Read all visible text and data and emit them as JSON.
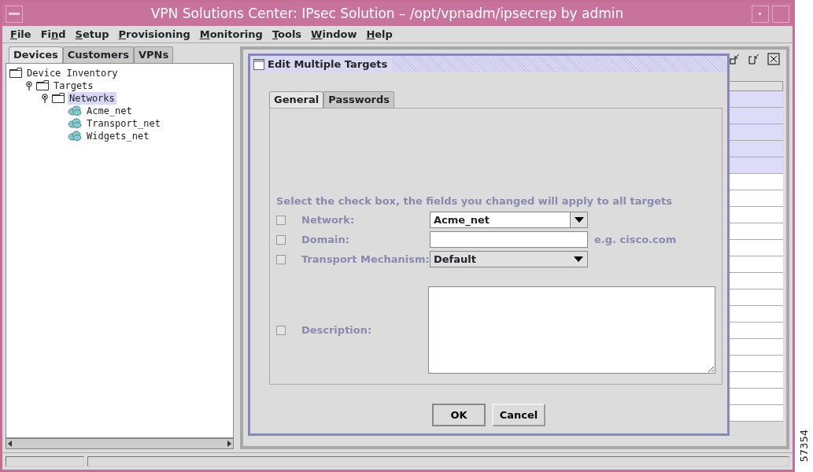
{
  "window": {
    "title": "VPN Solutions Center: IPsec Solution – /opt/vpnadm/ipsecrep by admin"
  },
  "menu": [
    {
      "segments": [
        {
          "text": "F",
          "underlined": true
        },
        {
          "text": "ile",
          "underlined": false
        }
      ]
    },
    {
      "segments": [
        {
          "text": "Fi",
          "underlined": false
        },
        {
          "text": "n",
          "underlined": true
        },
        {
          "text": "d",
          "underlined": false
        }
      ]
    },
    {
      "segments": [
        {
          "text": "S",
          "underlined": true
        },
        {
          "text": "etup",
          "underlined": false
        }
      ]
    },
    {
      "segments": [
        {
          "text": "P",
          "underlined": true
        },
        {
          "text": "rovisioning",
          "underlined": false
        }
      ]
    },
    {
      "segments": [
        {
          "text": "M",
          "underlined": true
        },
        {
          "text": "onitoring",
          "underlined": false
        }
      ]
    },
    {
      "segments": [
        {
          "text": "T",
          "underlined": true
        },
        {
          "text": "ools",
          "underlined": false
        }
      ]
    },
    {
      "segments": [
        {
          "text": "W",
          "underlined": true
        },
        {
          "text": "indow",
          "underlined": false
        }
      ]
    },
    {
      "segments": [
        {
          "text": "H",
          "underlined": true
        },
        {
          "text": "elp",
          "underlined": false
        }
      ]
    }
  ],
  "sidebar": {
    "tabs": [
      {
        "label": "Devices",
        "selected": true
      },
      {
        "label": "Customers",
        "selected": false
      },
      {
        "label": "VPNs",
        "selected": false
      }
    ],
    "tree": [
      {
        "label": "Device Inventory",
        "kind": "folder",
        "selected": false,
        "children": [
          {
            "label": "Targets",
            "kind": "folder",
            "selected": false,
            "expanded": true,
            "children": [
              {
                "label": "Networks",
                "kind": "folder",
                "selected": true,
                "expanded": true,
                "children": [
                  {
                    "label": "Acme_net",
                    "kind": "network",
                    "selected": false
                  },
                  {
                    "label": "Transport_net",
                    "kind": "network",
                    "selected": false
                  },
                  {
                    "label": "Widgets_net",
                    "kind": "network",
                    "selected": false
                  }
                ]
              }
            ]
          }
        ]
      }
    ]
  },
  "background_table": {
    "rows": [
      {
        "selected": true
      },
      {
        "selected": true
      },
      {
        "selected": true
      },
      {
        "selected": true
      },
      {
        "selected": true
      },
      {
        "selected": false
      },
      {
        "selected": false
      },
      {
        "selected": false
      },
      {
        "selected": false
      },
      {
        "selected": false
      },
      {
        "selected": false
      },
      {
        "selected": false
      },
      {
        "selected": false
      },
      {
        "selected": false
      },
      {
        "selected": false
      },
      {
        "selected": false
      },
      {
        "selected": false
      },
      {
        "selected": false
      },
      {
        "selected": false
      },
      {
        "selected": false
      }
    ]
  },
  "dialog": {
    "title": "Edit Multiple Targets",
    "tabs": [
      {
        "label": "General",
        "selected": true
      },
      {
        "label": "Passwords",
        "selected": false
      }
    ],
    "instruction": "Select the check box, the fields you changed will apply to all targets",
    "fields": [
      {
        "kind": "dropdown",
        "label": "Network:",
        "checked": false,
        "value": "Acme_net",
        "editable": true
      },
      {
        "kind": "text",
        "label": "Domain:",
        "checked": false,
        "hint": "e.g. cisco.com"
      },
      {
        "kind": "dropdown",
        "label": "Transport Mechanism:",
        "checked": false,
        "value": "Default",
        "editable": false
      },
      {
        "kind": "textarea",
        "label": "Description:",
        "checked": false
      }
    ],
    "buttons": [
      "OK",
      "Cancel"
    ]
  },
  "figure_id": "57354"
}
